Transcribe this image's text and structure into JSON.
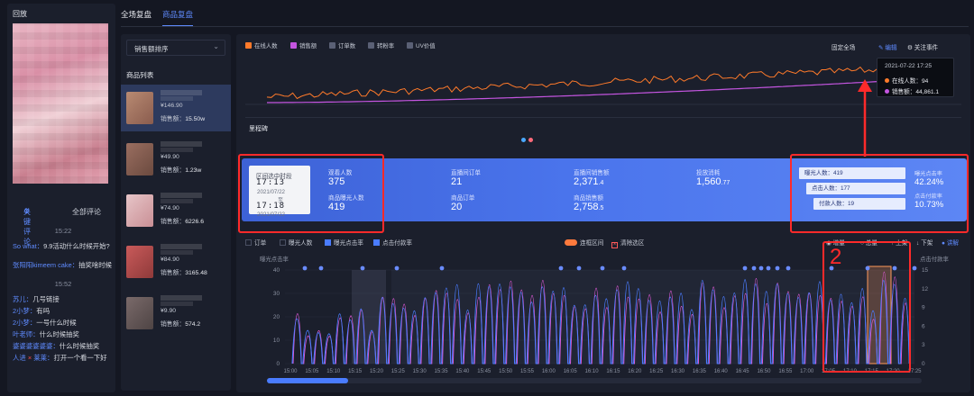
{
  "left": {
    "title": "回放",
    "comment_tabs": [
      "关键评论",
      "全部评论"
    ],
    "comments": [
      {
        "type": "time",
        "text": "15:22"
      },
      {
        "type": "msg",
        "user": "So what：",
        "text": "9.9活动什么时候开始?"
      },
      {
        "type": "msg",
        "user": "张阳阳kimeem cake：",
        "text": "抽奖啥时候"
      },
      {
        "type": "time",
        "text": "15:52"
      },
      {
        "type": "msg",
        "user": "苏儿：",
        "text": "几号链接"
      },
      {
        "type": "msg",
        "user": "2小梦：",
        "text": "有吗"
      },
      {
        "type": "msg",
        "user": "2小梦：",
        "text": "一号什么时候"
      },
      {
        "type": "msg",
        "user": "叶老师：",
        "text": "什么时候抽奖"
      },
      {
        "type": "msg",
        "user": "婆婆婆婆婆婆：",
        "text": "什么时候抽奖"
      },
      {
        "type": "msg",
        "user": "人进",
        "mark": "×",
        "user2": "莱莱：",
        "text": "打开一个看一下好"
      }
    ]
  },
  "top_tabs": [
    "全场复盘",
    "商品复盘"
  ],
  "product_panel": {
    "sort_label": "销售额排序",
    "list_title": "商品列表",
    "sales_prefix": "销售额：",
    "items": [
      {
        "price": "¥146.90",
        "sales": "15.50w",
        "color1": "#b88a72",
        "color2": "#8a5c4e",
        "selected": true
      },
      {
        "price": "¥49.90",
        "sales": "1.23w",
        "color1": "#9a6e60",
        "color2": "#6b4a3f",
        "selected": false
      },
      {
        "price": "¥74.90",
        "sales": "6226.6",
        "color1": "#e7c5c8",
        "color2": "#c98f95",
        "selected": false
      },
      {
        "price": "¥84.90",
        "sales": "3165.48",
        "color1": "#c95a5a",
        "color2": "#8f3a3a",
        "selected": false
      },
      {
        "price": "¥9.90",
        "sales": "574.2",
        "color1": "#7a6a6a",
        "color2": "#4e4444",
        "selected": false
      }
    ]
  },
  "main": {
    "legend": [
      {
        "label": "在线人数",
        "color": "#ff7a2a",
        "on": true
      },
      {
        "label": "销售额",
        "color": "#c455e0",
        "on": true
      },
      {
        "label": "订单数",
        "color": "#5a6075",
        "on": false
      },
      {
        "label": "转粉率",
        "color": "#5a6075",
        "on": false
      },
      {
        "label": "UV价值",
        "color": "#5a6075",
        "on": false
      }
    ],
    "controls": [
      "固定全场",
      "编辑",
      "关注事件"
    ],
    "tooltip": {
      "time": "2021-07-22 17:25",
      "rows": [
        {
          "label": "在线人数：94",
          "color": "#ff7a2a"
        },
        {
          "label": "销售额：44,861.1",
          "color": "#c455e0"
        }
      ]
    },
    "milestone_label": "里程碑",
    "colors": {
      "online": "#ff7a2a",
      "sales": "#c455e0",
      "blue": "#4a7cff",
      "pink": "#e05ad8"
    }
  },
  "stats": {
    "interval": {
      "header": "区间选中时段",
      "start_time": "17:13",
      "start_date": "2021/07/22",
      "sep": "至",
      "end_time": "17:18",
      "end_date": "2021/07/22"
    },
    "metrics": [
      {
        "label": "观看人数",
        "value": "375"
      },
      {
        "label": "商品曝光人数",
        "value": "419"
      },
      {
        "label": "直播间订单",
        "value": "21"
      },
      {
        "label": "商品订单",
        "value": "20"
      },
      {
        "label": "直播间销售额",
        "value": "2,371",
        "dec": ".4"
      },
      {
        "label": "商品销售额",
        "value": "2,758",
        "dec": ".5"
      },
      {
        "label": "投放消耗",
        "value": "1,560",
        "dec": ".77"
      }
    ],
    "funnel": [
      {
        "label": "曝光人数：419"
      },
      {
        "label": "点击人数：177"
      },
      {
        "label": "付款人数：19"
      }
    ],
    "rates": [
      {
        "label": "曝光点击率",
        "value": "42.24%"
      },
      {
        "label": "点击付款率",
        "value": "10.73%"
      }
    ]
  },
  "bottom": {
    "checks": [
      {
        "label": "订单",
        "on": false
      },
      {
        "label": "曝光人数",
        "on": false
      },
      {
        "label": "曝光点击率",
        "on": true
      },
      {
        "label": "点击付款率",
        "on": true
      }
    ],
    "toggle_label": "连框区间",
    "clear_label": "清除选区",
    "right_controls": [
      "增量",
      "总量",
      "上架",
      "下架",
      "讲解"
    ],
    "left_axis_title": "曝光点击率",
    "right_axis_title": "点击付款率",
    "left_ticks": [
      "40",
      "30",
      "20",
      "10",
      "0"
    ],
    "right_ticks": [
      "15",
      "12",
      "9",
      "6",
      "3",
      "0"
    ],
    "x_ticks": [
      "15:00",
      "15:05",
      "15:10",
      "15:15",
      "15:20",
      "15:25",
      "15:30",
      "15:35",
      "15:40",
      "15:45",
      "15:50",
      "15:55",
      "16:00",
      "16:05",
      "16:10",
      "16:15",
      "16:20",
      "16:25",
      "16:30",
      "16:35",
      "16:40",
      "16:45",
      "16:50",
      "16:55",
      "17:00",
      "17:05",
      "17:10",
      "17:15",
      "17:20",
      "17:25"
    ]
  },
  "annotation_label": "2"
}
